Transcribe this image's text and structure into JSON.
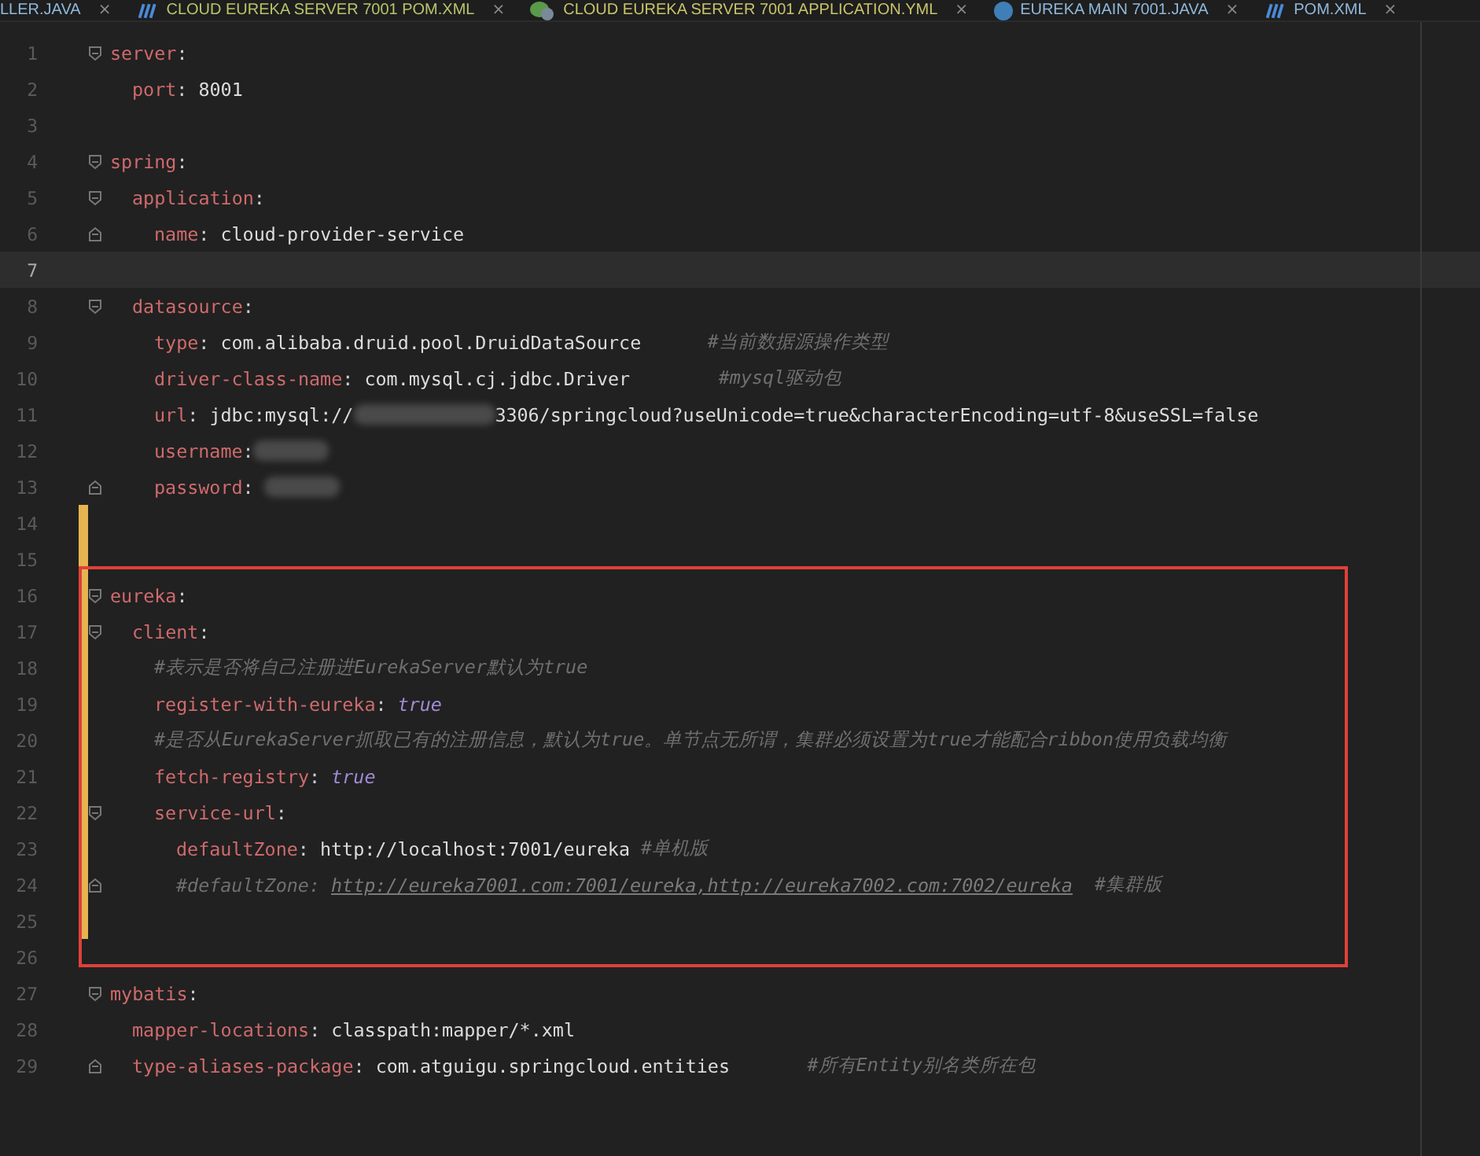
{
  "tabs": [
    {
      "label": "LLER.JAVA",
      "kind": "plain",
      "color": "#8fb8dc",
      "close": "×"
    },
    {
      "label": "CLOUD EUREKA SERVER 7001 POM.XML",
      "kind": "maven",
      "color": "#b9c46a",
      "close": "×"
    },
    {
      "label": "CLOUD EUREKA SERVER 7001 APPLICATION.YML",
      "kind": "spring",
      "color": "#c8c46a",
      "close": "×"
    },
    {
      "label": "EUREKA MAIN 7001.JAVA",
      "kind": "java",
      "color": "#8fb8dc",
      "close": "×"
    },
    {
      "label": "POM.XML",
      "kind": "maven",
      "color": "#8fb8dc",
      "close": "×"
    }
  ],
  "editor": {
    "lines": [
      {
        "number": "1",
        "fold_start": true,
        "fold_end": false,
        "changed": false,
        "current": false,
        "tokens": [
          {
            "kind": "key",
            "text": "server"
          },
          {
            "kind": "punct",
            "text": ":"
          }
        ],
        "children": [
          {
            "number": "2",
            "fold_start": false,
            "fold_end": false,
            "changed": false,
            "current": false,
            "tokens": [
              {
                "kind": "key",
                "text": "port"
              },
              {
                "kind": "punct",
                "text": ": "
              },
              {
                "kind": "value",
                "text": "8001"
              }
            ]
          }
        ]
      },
      {
        "number": "3",
        "fold_start": false,
        "fold_end": false,
        "changed": false,
        "current": false
      },
      {
        "number": "4",
        "fold_start": true,
        "fold_end": false,
        "changed": false,
        "current": false,
        "tokens": [
          {
            "kind": "key",
            "text": "spring"
          },
          {
            "kind": "punct",
            "text": ":"
          }
        ],
        "children": [
          {
            "number": "5",
            "fold_start": true,
            "fold_end": false,
            "changed": false,
            "current": false,
            "tokens": [
              {
                "kind": "key",
                "text": "application"
              },
              {
                "kind": "punct",
                "text": ":"
              }
            ],
            "children": [
              {
                "number": "6",
                "fold_start": false,
                "fold_end": true,
                "changed": false,
                "current": false,
                "tokens": [
                  {
                    "kind": "key",
                    "text": "name"
                  },
                  {
                    "kind": "punct",
                    "text": ": "
                  },
                  {
                    "kind": "value",
                    "text": "cloud-provider-service"
                  }
                ]
              }
            ]
          },
          {
            "number": "7",
            "fold_start": false,
            "fold_end": false,
            "changed": false,
            "current": true
          },
          {
            "number": "8",
            "fold_start": true,
            "fold_end": false,
            "changed": false,
            "current": false,
            "tokens": [
              {
                "kind": "key",
                "text": "datasource"
              },
              {
                "kind": "punct",
                "text": ":"
              }
            ],
            "children": [
              {
                "number": "9",
                "fold_start": false,
                "fold_end": false,
                "changed": false,
                "current": false,
                "tokens": [
                  {
                    "kind": "key",
                    "text": "type"
                  },
                  {
                    "kind": "punct",
                    "text": ": "
                  },
                  {
                    "kind": "value",
                    "text": "com.alibaba.druid.pool.DruidDataSource"
                  },
                  {
                    "kind": "comment",
                    "text": "      #当前数据源操作类型"
                  }
                ]
              },
              {
                "number": "10",
                "fold_start": false,
                "fold_end": false,
                "changed": false,
                "current": false,
                "tokens": [
                  {
                    "kind": "key",
                    "text": "driver-class-name"
                  },
                  {
                    "kind": "punct",
                    "text": ": "
                  },
                  {
                    "kind": "value",
                    "text": "com.mysql.cj.jdbc.Driver"
                  },
                  {
                    "kind": "comment",
                    "text": "        #mysql驱动包"
                  }
                ]
              },
              {
                "number": "11",
                "fold_start": false,
                "fold_end": false,
                "changed": false,
                "current": false,
                "tokens": [
                  {
                    "kind": "key",
                    "text": "url"
                  },
                  {
                    "kind": "punct",
                    "text": ": "
                  },
                  {
                    "kind": "value",
                    "text": "jdbc:mysql://"
                  },
                  {
                    "kind": "redacted"
                  },
                  {
                    "kind": "value",
                    "text": "3306/springcloud?useUnicode=true&characterEncoding=utf-8&useSSL=false"
                  }
                ]
              },
              {
                "number": "12",
                "fold_start": false,
                "fold_end": false,
                "changed": false,
                "current": false,
                "tokens": [
                  {
                    "kind": "key",
                    "text": "username"
                  },
                  {
                    "kind": "punct",
                    "text": ":"
                  },
                  {
                    "kind": "redacted"
                  }
                ]
              },
              {
                "number": "13",
                "fold_start": false,
                "fold_end": true,
                "changed": false,
                "current": false,
                "tokens": [
                  {
                    "kind": "key",
                    "text": "password"
                  },
                  {
                    "kind": "punct",
                    "text": ": "
                  },
                  {
                    "kind": "redacted"
                  }
                ]
              }
            ]
          }
        ]
      },
      {
        "number": "14",
        "fold_start": false,
        "fold_end": false,
        "changed": true,
        "current": false
      },
      {
        "number": "15",
        "fold_start": false,
        "fold_end": false,
        "changed": true,
        "current": false
      },
      {
        "number": "16",
        "fold_start": true,
        "fold_end": false,
        "changed": true,
        "current": false,
        "tokens": [
          {
            "kind": "key",
            "text": "eureka"
          },
          {
            "kind": "punct",
            "text": ":"
          }
        ],
        "children": [
          {
            "number": "17",
            "fold_start": true,
            "fold_end": false,
            "changed": true,
            "current": false,
            "tokens": [
              {
                "kind": "key",
                "text": "client"
              },
              {
                "kind": "punct",
                "text": ":"
              }
            ],
            "children": [
              {
                "number": "18",
                "fold_start": false,
                "fold_end": false,
                "changed": true,
                "current": false,
                "tokens": [
                  {
                    "kind": "comment",
                    "text": "#表示是否将自己注册进EurekaServer默认为true"
                  }
                ]
              },
              {
                "number": "19",
                "fold_start": false,
                "fold_end": false,
                "changed": true,
                "current": false,
                "tokens": [
                  {
                    "kind": "key",
                    "text": "register-with-eureka"
                  },
                  {
                    "kind": "punct",
                    "text": ": "
                  },
                  {
                    "kind": "bool",
                    "text": "true"
                  }
                ]
              },
              {
                "number": "20",
                "fold_start": false,
                "fold_end": false,
                "changed": true,
                "current": false,
                "tokens": [
                  {
                    "kind": "comment",
                    "text": "#是否从EurekaServer抓取已有的注册信息，默认为true。单节点无所谓，集群必须设置为true才能配合ribbon使用负载均衡"
                  }
                ]
              },
              {
                "number": "21",
                "fold_start": false,
                "fold_end": false,
                "changed": true,
                "current": false,
                "tokens": [
                  {
                    "kind": "key",
                    "text": "fetch-registry"
                  },
                  {
                    "kind": "punct",
                    "text": ": "
                  },
                  {
                    "kind": "bool",
                    "text": "true"
                  }
                ]
              },
              {
                "number": "22",
                "fold_start": true,
                "fold_end": false,
                "changed": true,
                "current": false,
                "tokens": [
                  {
                    "kind": "key",
                    "text": "service-url"
                  },
                  {
                    "kind": "punct",
                    "text": ":"
                  }
                ],
                "children": [
                  {
                    "number": "23",
                    "fold_start": false,
                    "fold_end": false,
                    "changed": true,
                    "current": false,
                    "tokens": [
                      {
                        "kind": "key",
                        "text": "defaultZone"
                      },
                      {
                        "kind": "punct",
                        "text": ": "
                      },
                      {
                        "kind": "value",
                        "text": "http://localhost:7001/eureka"
                      },
                      {
                        "kind": "comment",
                        "text": " #单机版"
                      }
                    ]
                  },
                  {
                    "number": "24",
                    "fold_start": false,
                    "fold_end": true,
                    "changed": true,
                    "current": false,
                    "tokens": [
                      {
                        "kind": "comment",
                        "text": "#defaultZone: "
                      },
                      {
                        "kind": "link",
                        "text": "http://eureka7001.com:7001/eureka,http://eureka7002.com:7002/eureka"
                      },
                      {
                        "kind": "comment",
                        "text": "  #集群版"
                      }
                    ]
                  }
                ]
              }
            ]
          }
        ]
      },
      {
        "number": "25",
        "fold_start": false,
        "fold_end": false,
        "changed": true,
        "current": false
      },
      {
        "number": "26",
        "fold_start": false,
        "fold_end": false,
        "changed": false,
        "current": false
      },
      {
        "number": "27",
        "fold_start": true,
        "fold_end": false,
        "changed": false,
        "current": false,
        "tokens": [
          {
            "kind": "key",
            "text": "mybatis"
          },
          {
            "kind": "punct",
            "text": ":"
          }
        ],
        "children": [
          {
            "number": "28",
            "fold_start": false,
            "fold_end": false,
            "changed": false,
            "current": false,
            "tokens": [
              {
                "kind": "key",
                "text": "mapper-locations"
              },
              {
                "kind": "punct",
                "text": ": "
              },
              {
                "kind": "value",
                "text": "classpath:mapper/*.xml"
              }
            ]
          },
          {
            "number": "29",
            "fold_start": false,
            "fold_end": true,
            "changed": false,
            "current": false,
            "tokens": [
              {
                "kind": "key",
                "text": "type-aliases-package"
              },
              {
                "kind": "punct",
                "text": ": "
              },
              {
                "kind": "value",
                "text": "com.atguigu.springcloud.entities"
              },
              {
                "kind": "comment",
                "text": "       #所有Entity别名类所在包"
              }
            ]
          }
        ]
      }
    ]
  }
}
